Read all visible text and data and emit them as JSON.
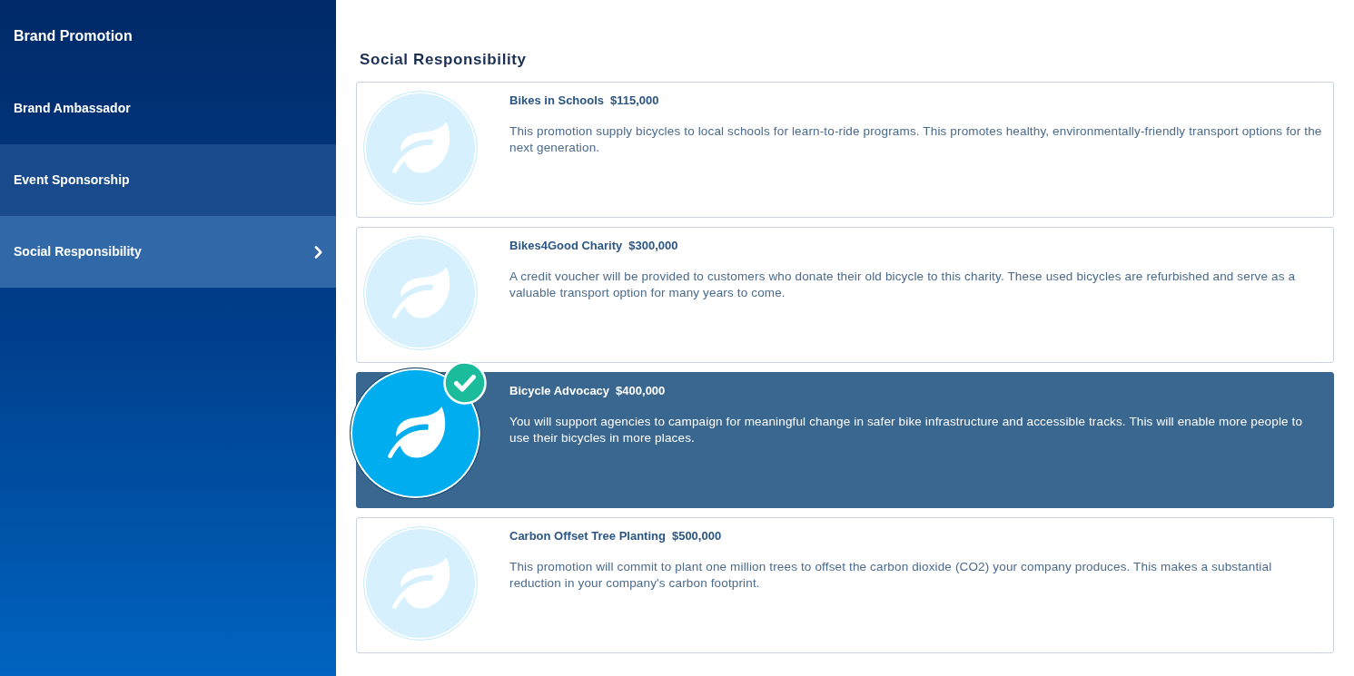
{
  "sidebar": {
    "title": "Brand Promotion",
    "items": [
      {
        "label": "Brand Ambassador",
        "selected": false,
        "highlighted": false
      },
      {
        "label": "Event Sponsorship",
        "selected": false,
        "highlighted": true
      },
      {
        "label": "Social Responsibility",
        "selected": true,
        "highlighted": false
      }
    ]
  },
  "main": {
    "heading": "Social Responsibility",
    "options": [
      {
        "name": "Bikes in Schools",
        "price": "$115,000",
        "description": "This promotion supply bicycles to local schools for learn-to-ride programs. This promotes healthy, environmentally-friendly transport options for the next generation.",
        "selected": false
      },
      {
        "name": "Bikes4Good Charity",
        "price": "$300,000",
        "description": "A credit voucher will be provided to customers who donate their old bicycle to this charity. These used bicycles are refurbished and serve as a valuable transport option for many years to come.",
        "selected": false
      },
      {
        "name": "Bicycle Advocacy",
        "price": "$400,000",
        "description": "You will support agencies to campaign for meaningful change in safer bike infrastructure and accessible tracks. This will enable more people to use their bicycles in more places.",
        "selected": true
      },
      {
        "name": "Carbon Offset Tree Planting",
        "price": "$500,000",
        "description": "This promotion will commit to plant one million trees to offset the carbon dioxide (CO2) your company produces. This makes a substantial reduction in your company's carbon footprint.",
        "selected": false
      }
    ]
  }
}
